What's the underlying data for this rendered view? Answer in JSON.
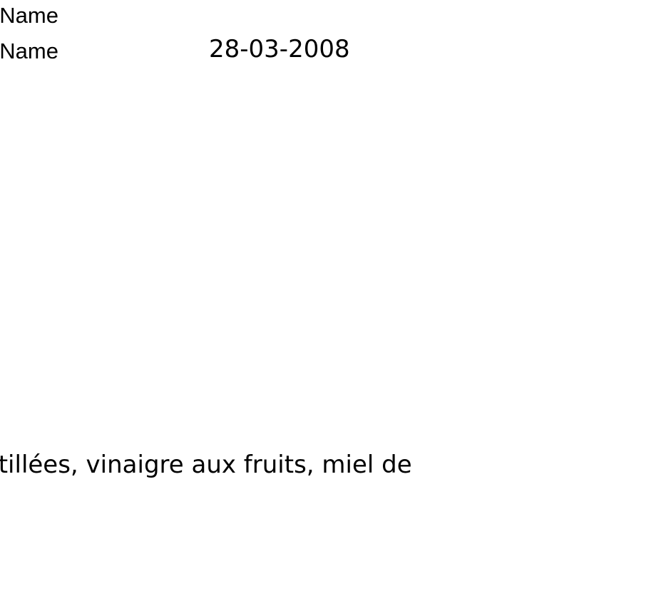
{
  "header": {
    "field_1_label": "oName",
    "field_2_label": "gName",
    "date": "28-03-2008"
  },
  "body": {
    "text_line": "stillées, vinaigre aux fruits, miel de"
  },
  "colors": {
    "background": "#ffffff",
    "text": "#000000"
  }
}
